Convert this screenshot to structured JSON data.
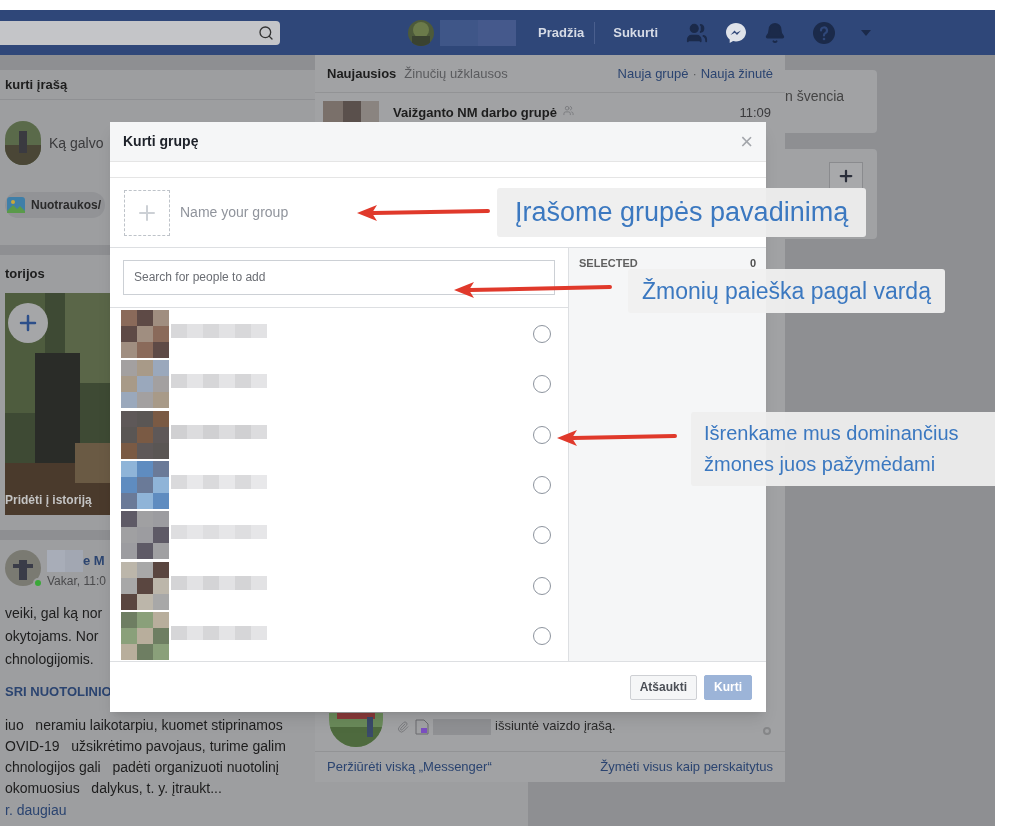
{
  "top_bar": {
    "nav": [
      {
        "label": "Pradžia"
      },
      {
        "label": "Sukurti"
      }
    ]
  },
  "feed": {
    "composer": {
      "title": "kurti įrašą",
      "prompt": "Ką galvo",
      "photo_button": "Nuotraukos/"
    },
    "stories": {
      "title": "torijos",
      "add_label": "Pridėti į istoriją"
    },
    "post": {
      "author": "e M",
      "time": "Vakar, 11:0",
      "online": true,
      "intro": [
        "veiki, gal ką nor",
        "okytojams. Nor",
        "chnologijomis."
      ],
      "link": "SRI NUOTOLINIO",
      "body": [
        "iuo   neramiu laikotarpiu, kuomet stiprinamos",
        "OVID-19   užsikrėtimo pavojaus, turime galim",
        "chnologijos gali   padėti organizuoti nuotolinį",
        "okomuosius   dalykus, t. y. įtraukt..."
      ],
      "more": "r. daugiau"
    }
  },
  "right_column": {
    "event": "n švencia"
  },
  "messenger": {
    "tabs": [
      {
        "label": "Naujausios",
        "selected": true
      },
      {
        "label": "Žinučių užklausos",
        "selected": false
      }
    ],
    "actions": [
      "Nauja grupė",
      "Nauja žinutė"
    ],
    "separator": "·",
    "top_thread": {
      "title": "Vaižganto NM darbo grupė",
      "time": "11:09"
    },
    "bottom_thread": {
      "preview": "išsiuntė vaizdo įrašą."
    },
    "footer": {
      "view_all": "Peržiūrėti viską „Messenger“",
      "mark_read": "Žymėti visus kaip perskaitytus"
    }
  },
  "dialog": {
    "title": "Kurti grupę",
    "close": "×",
    "name_field": {
      "placeholder": "Name your group"
    },
    "search_field": {
      "placeholder": "Search for people to add"
    },
    "selected_label": "SELECTED",
    "selected_count": "0",
    "buttons": [
      {
        "label": "Atšaukti",
        "kind": "secondary",
        "disabled": false
      },
      {
        "label": "Kurti",
        "kind": "primary",
        "disabled": true
      }
    ]
  },
  "annotations": [
    {
      "text": "Įrašome grupės pavadinimą"
    },
    {
      "text": "Žmonių paieška pagal vardą"
    },
    {
      "text": "Išrenkame mus dominančius žmones juos pažymėdami"
    }
  ]
}
